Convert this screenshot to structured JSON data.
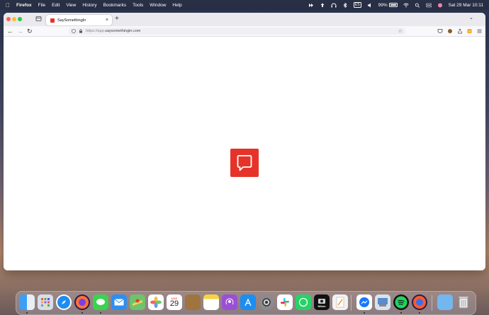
{
  "menubar": {
    "app": "Firefox",
    "menus": [
      "File",
      "Edit",
      "View",
      "History",
      "Bookmarks",
      "Tools",
      "Window",
      "Help"
    ],
    "input_indicator": "ES",
    "battery": "99%",
    "datetime": "Sat 29 Mar  10:11"
  },
  "browser": {
    "tab_title": "SaySomethingIn",
    "url_prefix": "https://app.",
    "url_host": "saysomethingin.com",
    "new_tab": "+",
    "tab_close": "×",
    "list_tabs": "⌄"
  },
  "page": {
    "logo_icon": "speech-bubble-icon",
    "logo_color": "#e5332a"
  },
  "dock": {
    "calendar_month": "MAR",
    "calendar_day": "29",
    "nikon_label": "Nikon",
    "icons": [
      "finder-icon",
      "launchpad-icon",
      "safari-icon",
      "firefox-icon",
      "messages-icon",
      "mail-icon",
      "maps-icon",
      "photos-icon",
      "calendar-icon",
      "notes-brown-icon",
      "notes-icon",
      "podcasts-icon",
      "app-store-icon",
      "system-settings-icon",
      "slack-icon",
      "whatsapp-icon",
      "nikon-icon",
      "pages-icon",
      "messenger-icon",
      "preview-icon",
      "spotify-icon",
      "firefox-dev-icon",
      "folder-icon",
      "trash-icon"
    ]
  }
}
